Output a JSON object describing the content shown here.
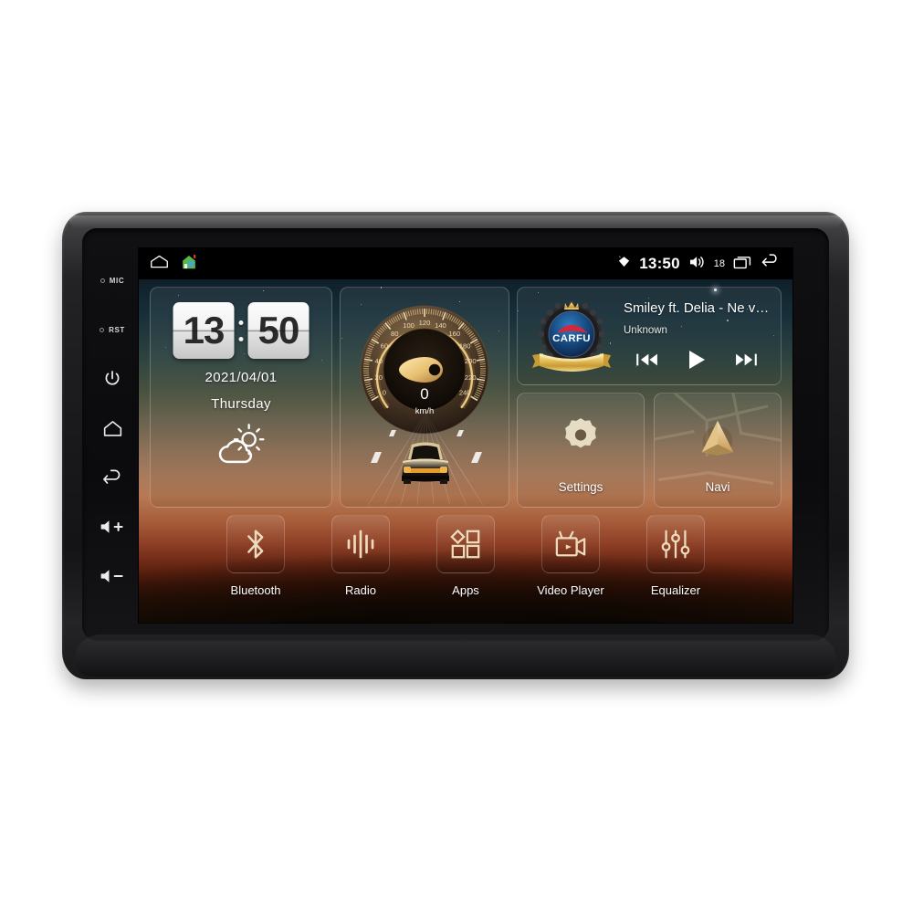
{
  "device": {
    "bezel_buttons": [
      {
        "name": "mic",
        "label": "MIC",
        "type": "label-dot"
      },
      {
        "name": "reset",
        "label": "RST",
        "type": "label-dot"
      },
      {
        "name": "power",
        "label": "",
        "type": "icon"
      },
      {
        "name": "home",
        "label": "",
        "type": "icon"
      },
      {
        "name": "back",
        "label": "",
        "type": "icon"
      },
      {
        "name": "volume-up",
        "label": "+",
        "type": "icon"
      },
      {
        "name": "volume-down",
        "label": "−",
        "type": "icon"
      }
    ]
  },
  "statusbar": {
    "home_icon": "home-outline-icon",
    "launcher_icon": "house-color-icon",
    "signal_icon": "signal-diamond-icon",
    "time": "13:50",
    "volume_icon": "volume-icon",
    "volume_level": "18",
    "recents_icon": "recents-icon",
    "back_icon": "back-arrow-icon"
  },
  "clock_widget": {
    "hours": "13",
    "minutes": "50",
    "date": "2021/04/01",
    "weekday": "Thursday",
    "weather_icon": "partly-cloudy-icon"
  },
  "speed_widget": {
    "value": "0",
    "unit": "km/h",
    "ticks": [
      "0",
      "20",
      "40",
      "60",
      "80",
      "100",
      "120",
      "140",
      "160",
      "180",
      "200",
      "220",
      "240"
    ],
    "min": 0,
    "max": 240
  },
  "music_widget": {
    "title": "Smiley ft. Delia - Ne v…",
    "artist": "Unknown",
    "album_art": "carfu-badge",
    "album_art_text": "CARFU",
    "prev_label": "prev-track-icon",
    "play_label": "play-icon",
    "next_label": "next-track-icon"
  },
  "shortcuts": [
    {
      "label": "Settings",
      "icon": "gear-icon"
    },
    {
      "label": "Navi",
      "icon": "navigation-arrow-icon"
    }
  ],
  "dock": [
    {
      "label": "Bluetooth",
      "icon": "bluetooth-icon"
    },
    {
      "label": "Radio",
      "icon": "radio-waves-icon"
    },
    {
      "label": "Apps",
      "icon": "apps-grid-icon"
    },
    {
      "label": "Video Player",
      "icon": "video-camera-icon"
    },
    {
      "label": "Equalizer",
      "icon": "equalizer-sliders-icon"
    }
  ],
  "colors": {
    "accent_gold": "#d8b070",
    "bezel": "#1a1a1c",
    "statusbar_bg": "#000000",
    "text_primary": "#ffffff"
  }
}
